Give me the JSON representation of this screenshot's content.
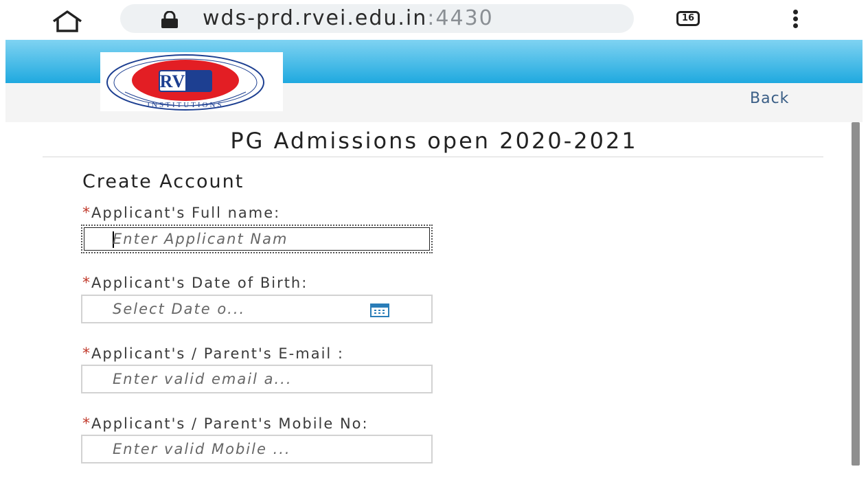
{
  "browser": {
    "url_host": "wds-prd.rvei.edu.in",
    "url_port": ":4430",
    "tab_count": "16",
    "icons": {
      "home": "home-icon",
      "lock": "lock-icon",
      "menu": "overflow-menu-icon"
    }
  },
  "header": {
    "logo_text": "RV",
    "logo_ring_text": "INSTITUTIONS",
    "back_label": "Back"
  },
  "page": {
    "title": "PG Admissions open 2020-2021",
    "section_title": "Create Account"
  },
  "form": {
    "required_mark": "*",
    "fields": [
      {
        "label": "Applicant's Full name:",
        "placeholder": "Enter Applicant Nam"
      },
      {
        "label": "Applicant's Date of Birth:",
        "placeholder": "Select Date o..."
      },
      {
        "label": "Applicant's / Parent's E-mail :",
        "placeholder": "Enter valid email a..."
      },
      {
        "label": "Applicant's / Parent's Mobile No:",
        "placeholder": "Enter valid Mobile ..."
      }
    ]
  },
  "colors": {
    "banner_top": "#7fd3f2",
    "banner_bottom": "#1fa9df",
    "required": "#c0392b",
    "link": "#3a5e86",
    "logo_red": "#e31e24",
    "logo_blue": "#1d3f91"
  }
}
